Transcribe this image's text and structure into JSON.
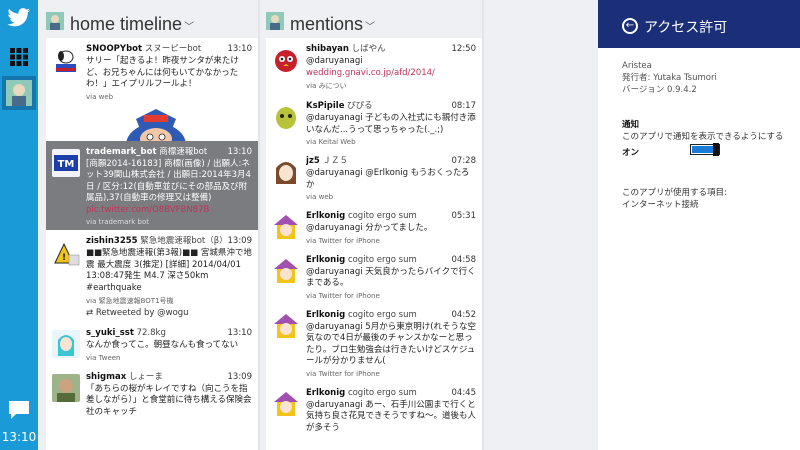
{
  "appbar": {
    "clock": "13:10"
  },
  "home": {
    "title": "home timeline",
    "tweets": [
      {
        "user": "SNOOPYbot",
        "display": "スヌーピーbot",
        "time": "13:10",
        "text": "サリー「起きるよ！昨夜サンタが来たけど、お兄ちゃんには何もいてかなかったわ！」エイプリルフールよ！",
        "via": "via web"
      },
      {
        "user": "trademark_bot",
        "display": "商標速報bot",
        "time": "13:10",
        "text": "[商願2014-16183] 商標(画像) / 出願人:ネット39関山株式会社 / 出願日:2014年3月4日 / 区分:12(自動車並びにその部品及び附属品),37(自動車の修理又は整備) ",
        "link": "pic.twitter.com/O8BVFBN87B",
        "via": "via trademark bot"
      },
      {
        "user": "zishin3255",
        "display": "緊急地震速報bot（β）",
        "time": "13:09",
        "text": "■■緊急地震速報(第3報)■■ 宮城県沖で地震 最大震度 3(推定) [詳細] 2014/04/01 13:08:47発生 M4.7 深さ50km #earthquake",
        "via": "via 緊急地震速報BOT1号機",
        "retweet": "Retweeted by @wogu"
      },
      {
        "user": "s_yuki_sst",
        "display": "72.8kg",
        "time": "13:10",
        "text": "なんか食ってこ。朝昼なんも食ってない",
        "via": "via Tween"
      },
      {
        "user": "shigmax",
        "display": "しょーま",
        "time": "13:09",
        "text": "「あちらの桜がキレイですね（向こうを指差しながら）」と食堂前に待ち構える保険会社のキャッチ",
        "via": ""
      }
    ]
  },
  "mentions": {
    "title": "mentions",
    "tweets": [
      {
        "user": "shibayan",
        "display": "しばやん",
        "time": "12:50",
        "text_pre": "@daruyanagi ",
        "link": "wedding.gnavi.co.jp/afd/2014/",
        "text": "",
        "via": "via みについ"
      },
      {
        "user": "KsPipile",
        "display": "ぴぴる",
        "time": "08:17",
        "text": "@daruyanagi 子どもの入社式にも親付き添いなんだ...うって思っちゃった(._.;)",
        "via": "via Keitai Web"
      },
      {
        "user": "jz5",
        "display": "ＪＺ５",
        "time": "07:28",
        "text": "@daruyanagi @Erlkonig もうおくったろか",
        "via": "via web"
      },
      {
        "user": "Erlkonig",
        "display": "cogito ergo sum",
        "time": "05:31",
        "text": "@daruyanagi 分かってました。",
        "via": "via Twitter for iPhone"
      },
      {
        "user": "Erlkonig",
        "display": "cogito ergo sum",
        "time": "04:58",
        "text": "@daruyanagi 天気良かったらバイクで行くまである。",
        "via": "via Twitter for iPhone"
      },
      {
        "user": "Erlkonig",
        "display": "cogito ergo sum",
        "time": "04:52",
        "text": "@daruyanagi 5月から東京明け(れそうな空気なので4日が最後のチャンスかなーと思ったり。ブロ生勉強会は行きたいけどスケジュールが分かりません(",
        "via": "via Twitter for iPhone"
      },
      {
        "user": "Erlkonig",
        "display": "cogito ergo sum",
        "time": "04:45",
        "text": "@daruyanagi あー、石手川公園まで行くと気持ち良さ花見できそうですね～。道後も人が多そう",
        "via": ""
      }
    ]
  },
  "pane": {
    "title": "アクセス許可",
    "app_name": "Aristea",
    "publisher": "発行者: Yutaka Tsumori",
    "version": "バージョン 0.9.4.2",
    "notif_title": "通知",
    "notif_desc": "このアプリで通知を表示できるようにする",
    "on_label": "オン",
    "perm_title": "このアプリが使用する項目:",
    "perm_value": "インターネット接続"
  },
  "colors": {
    "appbar": "#1a9bd7",
    "pane_header": "#1a2f78",
    "toggle_fill": "#1a7bd7",
    "link": "#c03358"
  }
}
